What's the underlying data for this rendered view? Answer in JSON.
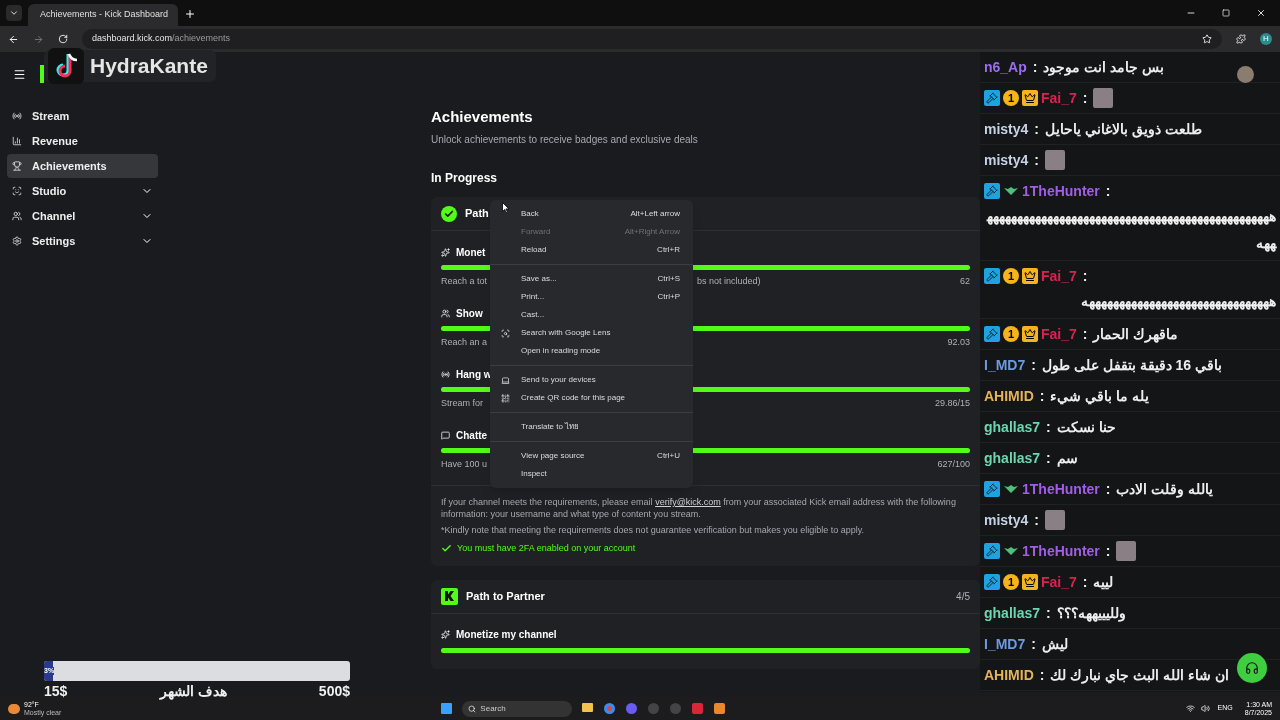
{
  "browser": {
    "tab_title": "Achievements - Kick Dashboard",
    "url_host": "dashboard.kick.com",
    "url_path": "/achievements",
    "profile_initial": "H"
  },
  "overlay": {
    "brand": "HydraKante"
  },
  "sidebar": {
    "items": [
      {
        "label": "Stream",
        "selected": false,
        "expandable": false
      },
      {
        "label": "Revenue",
        "selected": false,
        "expandable": false
      },
      {
        "label": "Achievements",
        "selected": true,
        "expandable": false
      },
      {
        "label": "Studio",
        "selected": false,
        "expandable": true
      },
      {
        "label": "Channel",
        "selected": false,
        "expandable": true
      },
      {
        "label": "Settings",
        "selected": false,
        "expandable": true
      }
    ]
  },
  "main": {
    "title": "Achievements",
    "subtitle": "Unlock achievements to receive badges and exclusive deals",
    "section": "In Progress",
    "card": {
      "title": "Path",
      "tasks": [
        {
          "title": "Monet",
          "level": 1,
          "description": "Reach a tot",
          "description_end": "bs not included)",
          "reading": "62"
        },
        {
          "title": "Show",
          "level": 1,
          "description": "Reach an a",
          "reading": "92.03"
        },
        {
          "title": "Hang w",
          "level": 1,
          "description": "Stream for",
          "reading": "29.86/15"
        },
        {
          "title": "Chatte",
          "level": 1,
          "description": "Have 100 u",
          "reading": "627/100"
        }
      ],
      "info_before_link": "If your channel meets the requirements, please email ",
      "info_link": "verify@kick.com",
      "info_after_link": " from your associated Kick email address with the following information: your username and what type of content you stream.",
      "note": "*Kindly note that meeting the requirements does not guarantee verification but makes you eligible to apply.",
      "requirement": {
        "label": "You must have 2FA enabled on your account",
        "met": true
      }
    },
    "card2": {
      "title": "Path to Partner",
      "count": "4/5",
      "tasks": [
        {
          "title": "Monetize my channel",
          "level": 1
        }
      ]
    }
  },
  "context_menu": [
    {
      "kind": "item",
      "label": "Back",
      "shortcut": "Alt+Left arrow",
      "disabled": false
    },
    {
      "kind": "item",
      "label": "Forward",
      "shortcut": "Alt+Right Arrow",
      "disabled": true
    },
    {
      "kind": "item",
      "label": "Reload",
      "shortcut": "Ctrl+R",
      "disabled": false
    },
    {
      "kind": "separator"
    },
    {
      "kind": "item",
      "label": "Save as...",
      "shortcut": "Ctrl+S",
      "disabled": false
    },
    {
      "kind": "item",
      "label": "Print...",
      "shortcut": "Ctrl+P",
      "disabled": false
    },
    {
      "kind": "item",
      "label": "Cast...",
      "disabled": false
    },
    {
      "kind": "item",
      "label": "Search with Google Lens",
      "disabled": false
    },
    {
      "kind": "item",
      "label": "Open in reading mode",
      "disabled": false
    },
    {
      "kind": "separator"
    },
    {
      "kind": "item",
      "label": "Send to your devices",
      "disabled": false
    },
    {
      "kind": "item",
      "label": "Create QR code for this page",
      "disabled": false
    },
    {
      "kind": "separator"
    },
    {
      "kind": "item",
      "label": "Translate to ไทย",
      "disabled": false
    },
    {
      "kind": "separator"
    },
    {
      "kind": "item",
      "label": "View page source",
      "shortcut": "Ctrl+U",
      "disabled": false
    },
    {
      "kind": "item",
      "label": "Inspect",
      "disabled": false
    }
  ],
  "chat": [
    {
      "user": "n6_Ap",
      "color": "#9b6cf0",
      "separator": ":",
      "kind": "text",
      "text": "بس جامد انت موجود"
    },
    {
      "user": "Fai_7",
      "color": "#d9234f",
      "badges": [
        {
          "kind": "mod"
        },
        {
          "kind": "gifter",
          "label": "1"
        },
        {
          "kind": "crown"
        }
      ],
      "separator": ":",
      "kind": "emote"
    },
    {
      "user": "misty4",
      "color": "#c8d2e6",
      "separator": ":",
      "kind": "text",
      "text": "طلعت ذويق بالاغاني ياحايل"
    },
    {
      "user": "misty4",
      "color": "#c8d2e6",
      "separator": ":",
      "kind": "emote"
    },
    {
      "user": "1TheHunter",
      "color": "#a35ee8",
      "badges": [
        {
          "kind": "mod"
        },
        {
          "kind": "wings"
        }
      ],
      "separator": ":",
      "kind": "long",
      "text": "ههههههههههههههههههههههههههههههههههههههههههههههههههه"
    },
    {
      "user": "Fai_7",
      "color": "#d9234f",
      "badges": [
        {
          "kind": "mod"
        },
        {
          "kind": "gifter",
          "label": "1"
        },
        {
          "kind": "crown"
        }
      ],
      "separator": ":",
      "kind": "long",
      "text": "هههههههههههههههههههههههههههههههه"
    },
    {
      "user": "Fai_7",
      "color": "#d9234f",
      "badges": [
        {
          "kind": "mod"
        },
        {
          "kind": "gifter",
          "label": "1"
        },
        {
          "kind": "crown"
        }
      ],
      "separator": ":",
      "kind": "text",
      "text": "ماقهرك الحمار"
    },
    {
      "user": "I_MD7",
      "color": "#6d9be0",
      "separator": ":",
      "kind": "text",
      "text": "باقي 16 دقيقة بتقفل على طول"
    },
    {
      "user": "AHIMID",
      "color": "#e6b35a",
      "separator": ":",
      "kind": "text",
      "text": "يله ما باقي شيء"
    },
    {
      "user": "ghallas7",
      "color": "#6cd6b0",
      "separator": ":",
      "kind": "text",
      "text": "حنا نسكت"
    },
    {
      "user": "ghallas7",
      "color": "#6cd6b0",
      "separator": ":",
      "kind": "text",
      "text": "سم"
    },
    {
      "user": "1TheHunter",
      "color": "#a35ee8",
      "badges": [
        {
          "kind": "mod"
        },
        {
          "kind": "wings"
        }
      ],
      "separator": ":",
      "kind": "text",
      "text": "يالله وقلت الادب"
    },
    {
      "user": "misty4",
      "color": "#c8d2e6",
      "separator": ":",
      "kind": "emote"
    },
    {
      "user": "1TheHunter",
      "color": "#a35ee8",
      "badges": [
        {
          "kind": "mod"
        },
        {
          "kind": "wings"
        }
      ],
      "separator": ":",
      "kind": "emote"
    },
    {
      "user": "Fai_7",
      "color": "#d9234f",
      "badges": [
        {
          "kind": "mod"
        },
        {
          "kind": "gifter",
          "label": "1"
        },
        {
          "kind": "crown"
        }
      ],
      "separator": ":",
      "kind": "text",
      "text": "لييه"
    },
    {
      "user": "ghallas7",
      "color": "#6cd6b0",
      "separator": ":",
      "kind": "text",
      "text": "ولليييههه؟؟؟"
    },
    {
      "user": "I_MD7",
      "color": "#6d9be0",
      "separator": ":",
      "kind": "text",
      "text": "ليش"
    },
    {
      "user": "AHIMID",
      "color": "#e6b35a",
      "separator": ":",
      "kind": "text",
      "text": "ان شاء الله البث جاي نبارك لك"
    }
  ],
  "goal": {
    "level": 0.03,
    "percent": "3%",
    "start": "15$",
    "label": "هدف الشهر",
    "end": "500$"
  },
  "taskbar": {
    "temperature": "92°F",
    "weather": "Mostly clear",
    "search_placeholder": "Search",
    "language": "ENG",
    "time": "1:30 AM",
    "date": "8/7/2025"
  }
}
